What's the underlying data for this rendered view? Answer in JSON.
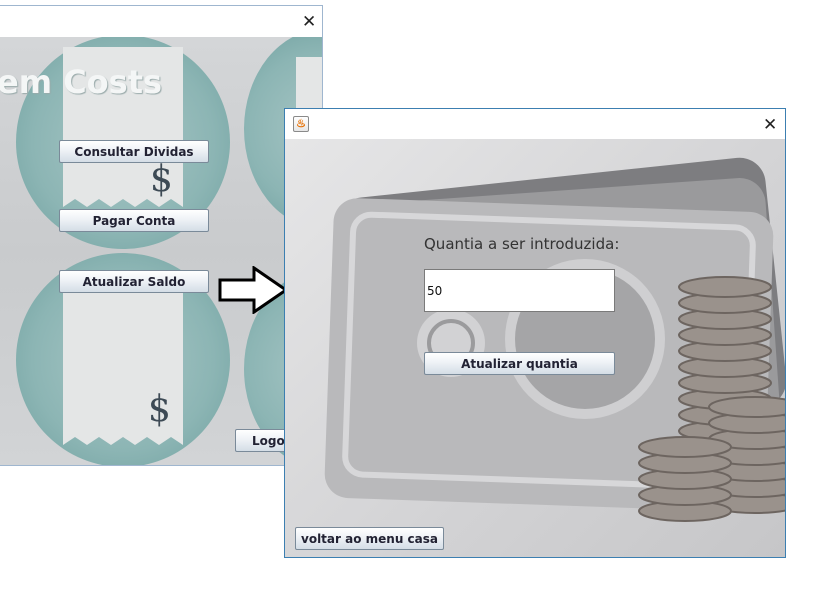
{
  "back_window": {
    "title_text": "em Costs",
    "close_glyph": "✕",
    "buttons": {
      "consultar": "Consultar Dividas",
      "pagar": "Pagar Conta",
      "atualizar_saldo": "Atualizar  Saldo",
      "logout": "Logou"
    },
    "dollar_glyph": "$"
  },
  "front_window": {
    "icon": "java-cup-icon",
    "close_glyph": "✕",
    "quantity_label": "Quantia a ser introduzida:",
    "quantity_value": "50",
    "update_button": "Atualizar quantia",
    "back_button": "voltar ao menu casa"
  },
  "colors": {
    "window_border_active": "#3c7fb1",
    "teal_circle": "#8cb5b4",
    "banknote_bg": "#d2d2d4"
  }
}
